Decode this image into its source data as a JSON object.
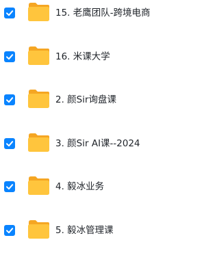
{
  "files": [
    {
      "name": "15. 老鹰团队-跨境电商",
      "checked": true
    },
    {
      "name": "16. 米课大学",
      "checked": true
    },
    {
      "name": "2. 颜Sir询盘课",
      "checked": true
    },
    {
      "name": "3. 颜Sir AI课--2024",
      "checked": true
    },
    {
      "name": "4. 毅冰业务",
      "checked": true
    },
    {
      "name": "5. 毅冰管理课",
      "checked": true
    }
  ],
  "colors": {
    "checkbox": "#0a84ff",
    "folder_front": "#ffc53d",
    "folder_back": "#f5a623",
    "text": "#1f2329"
  },
  "icons": {
    "checkbox": "checkmark-icon",
    "folder": "folder-icon"
  }
}
